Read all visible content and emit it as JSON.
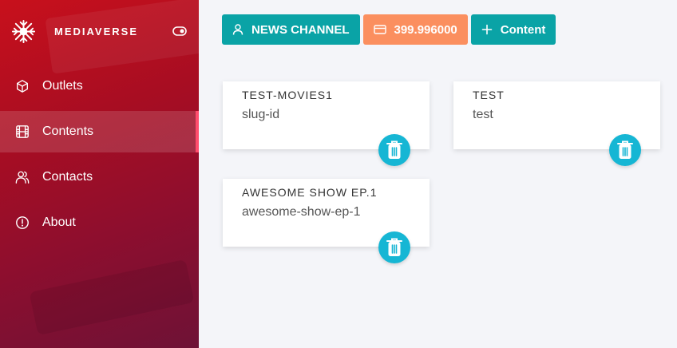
{
  "app": {
    "brand_name": "MEDIAVERSE"
  },
  "colors": {
    "teal": "#0aa3a6",
    "orange": "#fb8f5f",
    "delete": "#16b6d4",
    "sidebar_red": "#b30e22",
    "active_marker": "#ff4d6d"
  },
  "sidebar": {
    "items": [
      {
        "label": "Outlets",
        "icon": "cube-icon",
        "active": false
      },
      {
        "label": "Contents",
        "icon": "film-icon",
        "active": true
      },
      {
        "label": "Contacts",
        "icon": "users-icon",
        "active": false
      },
      {
        "label": "About",
        "icon": "info-icon",
        "active": false
      }
    ]
  },
  "topbar": {
    "channel_label": "NEWS CHANNEL",
    "balance_label": "399.996000",
    "add_content_label": "Content"
  },
  "contents": [
    {
      "title": "TEST-MOVIES1",
      "slug": "slug-id"
    },
    {
      "title": "TEST",
      "slug": "test"
    },
    {
      "title": "AWESOME SHOW EP.1",
      "slug": "awesome-show-ep-1"
    }
  ]
}
